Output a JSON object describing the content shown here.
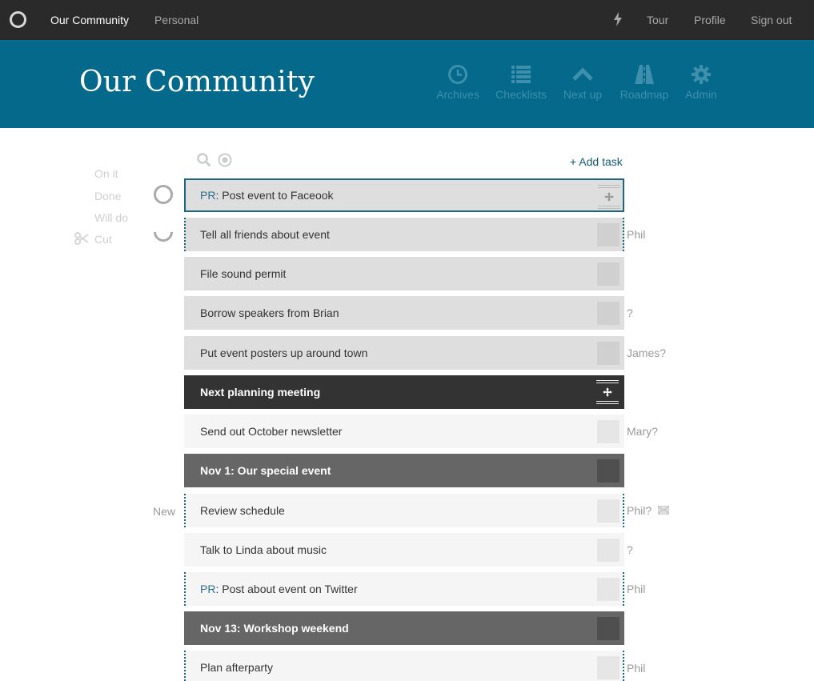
{
  "topbar": {
    "nav": [
      {
        "label": "Our Community",
        "active": true
      },
      {
        "label": "Personal",
        "active": false
      }
    ],
    "right": [
      "Tour",
      "Profile",
      "Sign out"
    ],
    "icons": {
      "logo": "circle-logo-icon",
      "activity": "bolt-icon"
    }
  },
  "header": {
    "title": "Our Community",
    "nav": [
      {
        "label": "Archives",
        "icon": "clock-icon"
      },
      {
        "label": "Checklists",
        "icon": "list-icon"
      },
      {
        "label": "Next up",
        "icon": "chevron-up-icon"
      },
      {
        "label": "Roadmap",
        "icon": "road-icon"
      },
      {
        "label": "Admin",
        "icon": "gear-icon"
      }
    ]
  },
  "legend": {
    "on_it": "On it",
    "done": "Done",
    "will_do": "Will do",
    "cut": "Cut"
  },
  "toolbar": {
    "add_task": "+ Add task",
    "icons": [
      "search-icon",
      "target-icon"
    ]
  },
  "tasks": [
    {
      "prefix": "PR",
      "text": ": Post event to Faceook",
      "style": "done-selected",
      "assignee": ""
    },
    {
      "prefix": "",
      "text": "Tell all friends about event",
      "style": "done",
      "assignee": "Phil"
    },
    {
      "prefix": "",
      "text": "File sound permit",
      "style": "done",
      "assignee": ""
    },
    {
      "prefix": "",
      "text": "Borrow speakers from Brian",
      "style": "done",
      "assignee": "?"
    },
    {
      "prefix": "",
      "text": "Put event posters up around town",
      "style": "done",
      "assignee": "James?"
    },
    {
      "prefix": "",
      "text": "Next planning meeting",
      "style": "milestone-current",
      "assignee": ""
    },
    {
      "prefix": "",
      "text": "Send out October newsletter",
      "style": "open",
      "assignee": "Mary?"
    },
    {
      "prefix": "",
      "text": "Nov 1: Our special event",
      "style": "milestone",
      "assignee": ""
    },
    {
      "prefix": "",
      "text": "Review schedule",
      "style": "open",
      "assignee": "Phil?"
    },
    {
      "prefix": "",
      "text": "Talk to Linda about music",
      "style": "open",
      "assignee": "?"
    },
    {
      "prefix": "PR",
      "text": ": Post about event on Twitter",
      "style": "open",
      "assignee": "Phil"
    },
    {
      "prefix": "",
      "text": "Nov 13: Workshop weekend",
      "style": "milestone",
      "assignee": ""
    },
    {
      "prefix": "",
      "text": "Plan afterparty",
      "style": "open",
      "assignee": "Phil"
    }
  ],
  "new_label": "New",
  "colors": {
    "topbar": "#2a2a2a",
    "header": "#04698b",
    "accent": "#1d6680",
    "done_row": "#dedede",
    "open_row": "#f5f5f5",
    "milestone_dark": "#333333",
    "milestone_mid": "#666666"
  }
}
